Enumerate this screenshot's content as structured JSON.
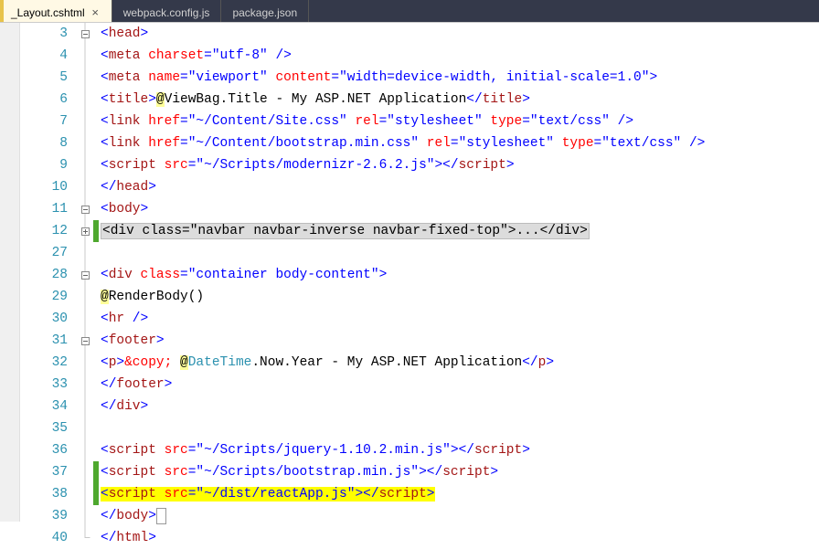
{
  "tabs": {
    "t0": "_Layout.cshtml",
    "t1": "webpack.config.js",
    "t2": "package.json"
  },
  "lines": {
    "n0": "3",
    "n1": "4",
    "n2": "5",
    "n3": "6",
    "n4": "7",
    "n5": "8",
    "n6": "9",
    "n7": "10",
    "n8": "11",
    "n9": "12",
    "n10": "27",
    "n11": "28",
    "n12": "29",
    "n13": "30",
    "n14": "31",
    "n15": "32",
    "n16": "33",
    "n17": "34",
    "n18": "35",
    "n19": "36",
    "n20": "37",
    "n21": "38",
    "n22": "39",
    "n23": "40"
  },
  "code": {
    "l3": {
      "a": "<",
      "b": "head",
      "c": ">"
    },
    "l4": {
      "a": "<",
      "b": "meta",
      "c": " ",
      "d": "charset",
      "e": "=\"utf-8\"",
      "f": " />"
    },
    "l5": {
      "a": "<",
      "b": "meta",
      "c": " ",
      "d": "name",
      "e": "=\"viewport\"",
      "f": " ",
      "g": "content",
      "h": "=\"width=device-width, initial-scale=1.0\"",
      "i": ">"
    },
    "l6": {
      "a": "<",
      "b": "title",
      "c": ">",
      "d": "@",
      "e": "ViewBag.Title",
      "f": " - My ASP.NET Application",
      "g": "</",
      "h": "title",
      "i": ">"
    },
    "l7": {
      "a": "<",
      "b": "link",
      "c": " ",
      "d": "href",
      "e": "=\"~/Content/Site.css\"",
      "f": " ",
      "g": "rel",
      "h": "=\"stylesheet\"",
      "i": " ",
      "j": "type",
      "k": "=\"text/css\"",
      "l": " />"
    },
    "l8": {
      "a": "<",
      "b": "link",
      "c": " ",
      "d": "href",
      "e": "=\"~/Content/bootstrap.min.css\"",
      "f": " ",
      "g": "rel",
      "h": "=\"stylesheet\"",
      "i": " ",
      "j": "type",
      "k": "=\"text/css\"",
      "l": " />"
    },
    "l9": {
      "a": "<",
      "b": "script",
      "c": " ",
      "d": "src",
      "e": "=\"~/Scripts/modernizr-2.6.2.js\"",
      "f": "></",
      "g": "script",
      "h": ">"
    },
    "l10": {
      "a": "</",
      "b": "head",
      "c": ">"
    },
    "l11": {
      "a": "<",
      "b": "body",
      "c": ">"
    },
    "l12": {
      "a": "<div class=\"navbar navbar-inverse navbar-fixed-top\">",
      "b": "...",
      "c": "</div>"
    },
    "l28": {
      "a": "<",
      "b": "div",
      "c": " ",
      "d": "class",
      "e": "=\"container body-content\"",
      "f": ">"
    },
    "l29": {
      "a": "@",
      "b": "RenderBody()"
    },
    "l30": {
      "a": "<",
      "b": "hr",
      "c": " />"
    },
    "l31": {
      "a": "<",
      "b": "footer",
      "c": ">"
    },
    "l32": {
      "a": "<",
      "b": "p",
      "c": ">",
      "d": "&copy;",
      "e": " ",
      "f": "@",
      "g": "DateTime",
      "h": ".Now.Year",
      "i": " - My ASP.NET Application",
      "j": "</",
      "k": "p",
      "l": ">"
    },
    "l33": {
      "a": "</",
      "b": "footer",
      "c": ">"
    },
    "l34": {
      "a": "</",
      "b": "div",
      "c": ">"
    },
    "l36": {
      "a": "<",
      "b": "script",
      "c": " ",
      "d": "src",
      "e": "=\"~/Scripts/jquery-1.10.2.min.js\"",
      "f": "></",
      "g": "script",
      "h": ">"
    },
    "l37": {
      "a": "<",
      "b": "script",
      "c": " ",
      "d": "src",
      "e": "=\"~/Scripts/bootstrap.min.js\"",
      "f": "></",
      "g": "script",
      "h": ">"
    },
    "l38": {
      "a": "<",
      "b": "script",
      "c": " ",
      "d": "src",
      "e": "=\"~/dist/reactApp.js\"",
      "f": ">",
      "g": "</",
      "h": "script",
      "i": ">"
    },
    "l39": {
      "a": "</",
      "b": "body",
      "c": ">"
    },
    "l40": {
      "a": "</",
      "b": "html",
      "c": ">"
    }
  }
}
